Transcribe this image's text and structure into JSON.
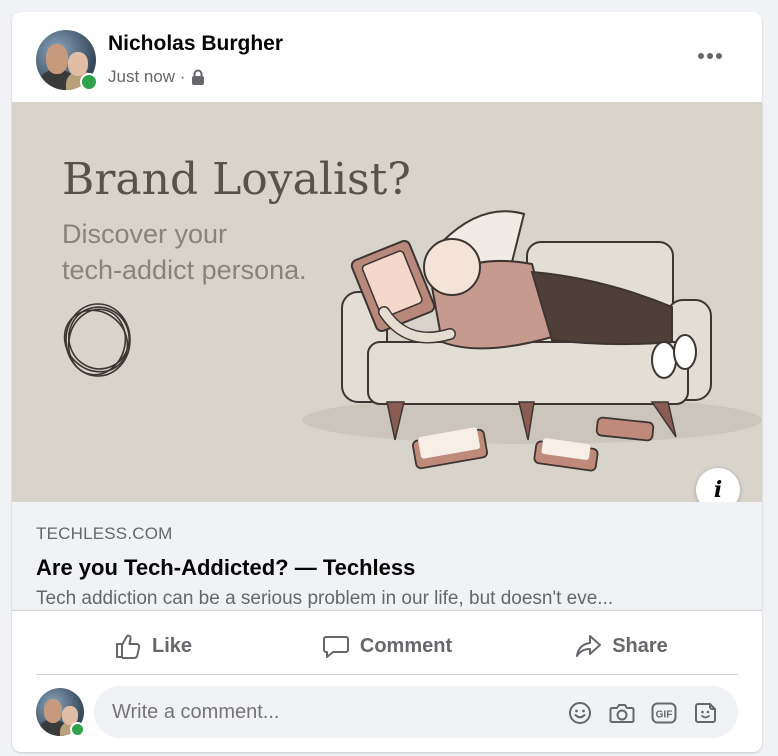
{
  "post": {
    "author": "Nicholas Burgher",
    "time": "Just now ·",
    "privacy_icon": "lock-icon",
    "more_icon": "more-dots-icon"
  },
  "banner": {
    "title": "Brand Loyalist?",
    "subtitle_line1": "Discover your",
    "subtitle_line2": "tech-addict persona.",
    "background": "#d8d3cb"
  },
  "link": {
    "domain": "TECHLESS.COM",
    "title": "Are you Tech-Addicted? — Techless",
    "description": "Tech addiction can be a serious problem in our life, but doesn't eve..."
  },
  "actions": {
    "like": "Like",
    "comment": "Comment",
    "share": "Share"
  },
  "comment": {
    "placeholder": "Write a comment...",
    "icons": [
      "emoji-icon",
      "camera-icon",
      "gif-icon",
      "sticker-icon"
    ]
  },
  "colors": {
    "online": "#31a24c",
    "secondary_text": "#65676b",
    "page_bg": "#f0f2f5"
  }
}
